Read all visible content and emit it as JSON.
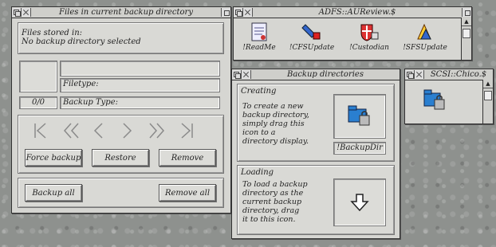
{
  "files_window": {
    "title": "Files in current backup directory",
    "stored_label": "Files stored in:",
    "stored_value": "No backup directory selected",
    "filetype_label": "Filetype:",
    "counter": "0/0",
    "backup_type_label": "Backup Type:",
    "force_backup": "Force backup",
    "restore": "Restore",
    "remove": "Remove",
    "backup_all": "Backup all",
    "remove_all": "Remove all"
  },
  "adfs_window": {
    "title": "ADFS::AUReview.$",
    "icons": [
      {
        "label": "!ReadMe",
        "icon": "readme-icon"
      },
      {
        "label": "!CFSUpdate",
        "icon": "cfsupdate-icon"
      },
      {
        "label": "!Custodian",
        "icon": "custodian-icon"
      },
      {
        "label": "!SFSUpdate",
        "icon": "sfsupdate-icon"
      }
    ]
  },
  "backup_window": {
    "title": "Backup directories",
    "creating_heading": "Creating",
    "creating_text": [
      "To create a new",
      "backup directory,",
      "simply drag this",
      "icon to a",
      "directory display."
    ],
    "backupdir_label": "!BackupDir",
    "loading_heading": "Loading",
    "loading_text": [
      "To load a backup",
      "directory as the",
      "current backup",
      "directory, drag",
      "it to this icon."
    ]
  },
  "scsi_window": {
    "title": "SCSI::Chico.$"
  }
}
